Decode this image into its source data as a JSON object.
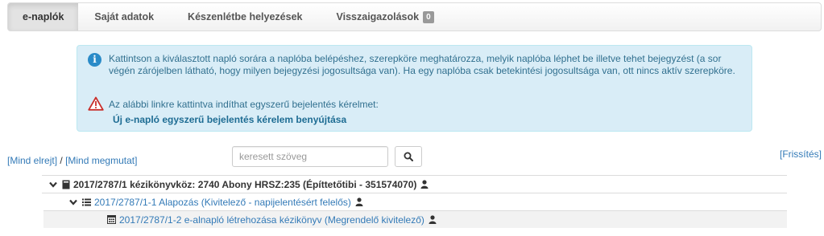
{
  "tabs": [
    {
      "label": "e-naplók",
      "active": true
    },
    {
      "label": "Saját adatok"
    },
    {
      "label": "Készenlétbe helyezések"
    },
    {
      "label": "Visszaigazolások",
      "badge": "0"
    }
  ],
  "alert": {
    "info_text": "Kattintson a kiválasztott napló sorára a naplóba belépéshez, szerepköre meghatározza, melyik naplóba léphet be illetve tehet bejegyzést (a sor végén zárójelben látható, hogy milyen bejegyzési jogosultsága van). Ha egy naplóba csak betekintési jogosultsága van, ott nincs aktív szerepköre.",
    "warn_text": "Az alábbi linkre kattintva indíthat egyszerű bejelentés kérelmet:",
    "link_text": "Új e-napló egyszerű bejelentés kérelem benyújtása"
  },
  "toolbar": {
    "collapse_all": "[Mind elrejt]",
    "separator": "/",
    "expand_all": "[Mind megmutat]",
    "search_placeholder": "keresett szöveg",
    "refresh": "[Frissítés]"
  },
  "tree": [
    {
      "label": "2017/2787/1 kézikönyvköz: 2740 Abony HRSZ:235 (Építtetőtibi - 351574070)",
      "icon": "book-icon",
      "level": 1
    },
    {
      "label": "2017/2787/1-1 Alapozás (Kivitelező - napijelentésért felelős)",
      "icon": "list-icon",
      "level": 2
    },
    {
      "label": "2017/2787/1-2 e-alnapló létrehozása kézikönyv (Megrendelő kivitelező)",
      "icon": "calendar-icon",
      "level": 3
    }
  ],
  "colors": {
    "alert_bg": "#d9edf7",
    "alert_text": "#31708f",
    "link": "#337ab7",
    "warn": "#c9302c"
  }
}
